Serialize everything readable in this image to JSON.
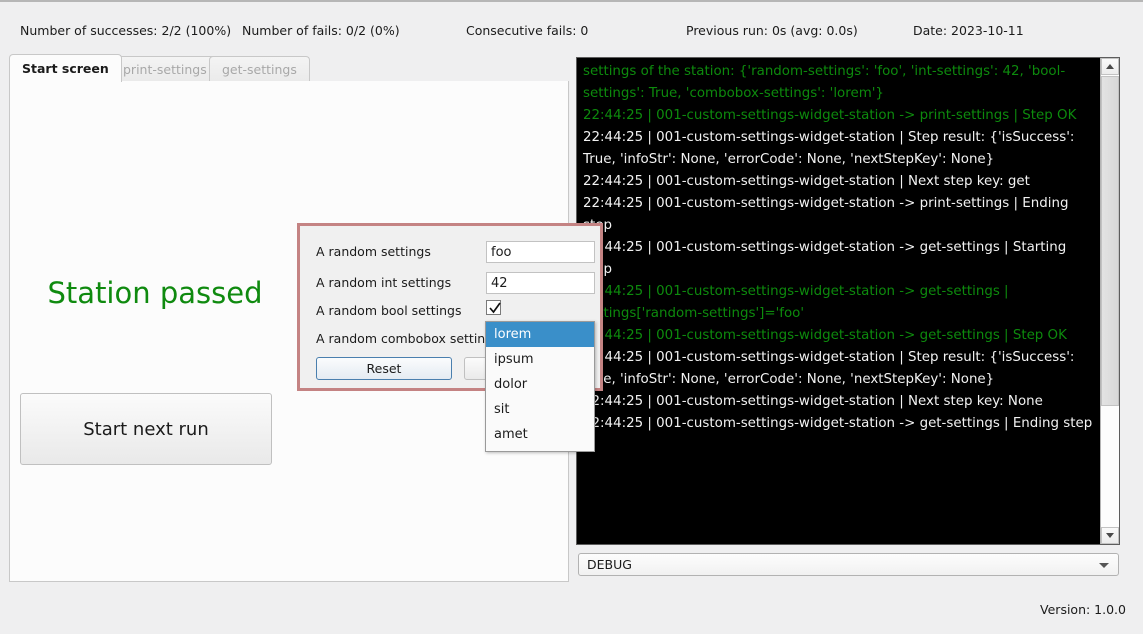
{
  "statusbar": {
    "successes": "Number of successes: 2/2 (100%)",
    "fails": "Number of fails: 0/2 (0%)",
    "consecutive_fails": "Consecutive fails: 0",
    "previous_run": "Previous run: 0s (avg: 0.0s)",
    "date": "Date: 2023-10-11"
  },
  "tabs": [
    {
      "label": "Start screen",
      "active": true
    },
    {
      "label": "print-settings",
      "active": false
    },
    {
      "label": "get-settings",
      "active": false
    }
  ],
  "start_screen": {
    "status_text": "Station passed",
    "status_color": "#0f8a0f",
    "start_button": "Start next run"
  },
  "log": {
    "lines": [
      {
        "color": "green",
        "text": "settings of the station: {'random-settings': 'foo', 'int-settings': 42, 'bool-settings': True, 'combobox-settings': 'lorem'}"
      },
      {
        "color": "green",
        "text": "22:44:25 | 001-custom-settings-widget-station -> print-settings | Step OK"
      },
      {
        "color": "white",
        "text": "22:44:25 | 001-custom-settings-widget-station | Step result: {'isSuccess': True, 'infoStr': None, 'errorCode': None, 'nextStepKey': None}"
      },
      {
        "color": "white",
        "text": "22:44:25 | 001-custom-settings-widget-station | Next step key: get"
      },
      {
        "color": "white",
        "text": "22:44:25 | 001-custom-settings-widget-station -> print-settings | Ending step"
      },
      {
        "color": "white",
        "text": "22:44:25 | 001-custom-settings-widget-station -> get-settings | Starting step"
      },
      {
        "color": "green",
        "text": "22:44:25 | 001-custom-settings-widget-station -> get-settings | settings['random-settings']='foo'"
      },
      {
        "color": "green",
        "text": "22:44:25 | 001-custom-settings-widget-station -> get-settings | Step OK"
      },
      {
        "color": "white",
        "text": "22:44:25 | 001-custom-settings-widget-station | Step result: {'isSuccess': True, 'infoStr': None, 'errorCode': None, 'nextStepKey': None}"
      },
      {
        "color": "white",
        "text": "22:44:25 | 001-custom-settings-widget-station | Next step key: None"
      },
      {
        "color": "white",
        "text": "22:44:25 | 001-custom-settings-widget-station -> get-settings | Ending step"
      }
    ],
    "green_color": "#0d8a0d",
    "text_color": "#f2f2f2",
    "background": "#000000"
  },
  "log_level": {
    "selected": "DEBUG"
  },
  "footer": {
    "version": "Version: 1.0.0"
  },
  "settings_dialog": {
    "border_color": "#c48383",
    "rows": [
      {
        "label": "A random settings",
        "value": "foo",
        "type": "text"
      },
      {
        "label": "A random int settings",
        "value": "42",
        "type": "text"
      },
      {
        "label": "A random bool settings",
        "value": "checked",
        "type": "checkbox"
      },
      {
        "label": "A random combobox settings",
        "value": "lorem",
        "type": "combobox"
      }
    ],
    "reset_button": "Reset",
    "other_button": ""
  },
  "combobox_popup": {
    "options": [
      "lorem",
      "ipsum",
      "dolor",
      "sit",
      "amet"
    ],
    "selected_index": 0,
    "highlight_color": "#3a8fc9"
  }
}
